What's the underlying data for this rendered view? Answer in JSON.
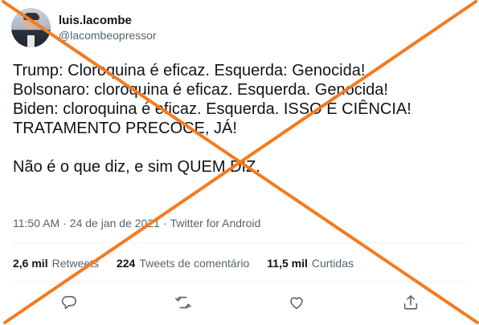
{
  "user": {
    "display_name": "luis.lacombe",
    "handle": "@lacombeopressor"
  },
  "tweet": {
    "text": "Trump: Cloroquina é eficaz. Esquerda: Genocida!\nBolsonaro: cloroquina é eficaz. Esquerda. Genocida!\nBiden: cloroquina é eficaz. Esquerda. ISSO É CIÊNCIA! TRATAMENTO PRECOCE, JÁ!\n\nNão é o que diz, e sim QUEM DIZ.",
    "time": "11:50 AM",
    "separator": "·",
    "date": "24 de jan de 2021",
    "source": "Twitter for Android"
  },
  "stats": {
    "retweets_count": "2,6 mil",
    "retweets_label": "Retweets",
    "comments_count": "224",
    "comments_label": "Tweets de comentário",
    "likes_count": "11,5 mil",
    "likes_label": "Curtidas"
  },
  "icons": {
    "reply": "reply-icon",
    "retweet": "retweet-icon",
    "like": "heart-icon",
    "share": "share-icon"
  },
  "colors": {
    "cross": "#f47b20",
    "text": "#0f1419",
    "secondary": "#536471",
    "divider": "#eff3f4"
  }
}
